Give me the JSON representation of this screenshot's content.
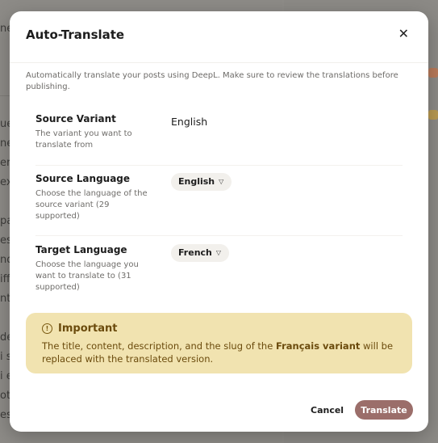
{
  "background": {
    "left_fragments": [
      "ne",
      "ue",
      "ne",
      "er",
      "ex",
      "pa",
      "es",
      "nd",
      "iff",
      "nt",
      "de",
      "i s",
      "i e",
      "ott",
      "es"
    ]
  },
  "modal": {
    "title": "Auto-Translate",
    "close_label": "✕",
    "description": "Automatically translate your posts using DeepL. Make sure to review the translations before publishing.",
    "rows": [
      {
        "label": "Source Variant",
        "help": "The variant you want to translate from",
        "value": "English"
      },
      {
        "label": "Source Language",
        "help": "Choose the language of the source variant (29 supported)",
        "value": "English"
      },
      {
        "label": "Target Language",
        "help": "Choose the language you want to translate to (31 supported)",
        "value": "French"
      }
    ],
    "callout": {
      "title": "Important",
      "body_prefix": "The title, content, description, and the slug of the ",
      "body_bold": "Français variant",
      "body_suffix": " will be replaced with the translated version."
    },
    "cancel_label": "Cancel",
    "translate_label": "Translate"
  },
  "colors": {
    "accent_button": "#9b6e6a",
    "callout_bg": "#f1e3b0",
    "callout_text": "#6b4b0d"
  }
}
